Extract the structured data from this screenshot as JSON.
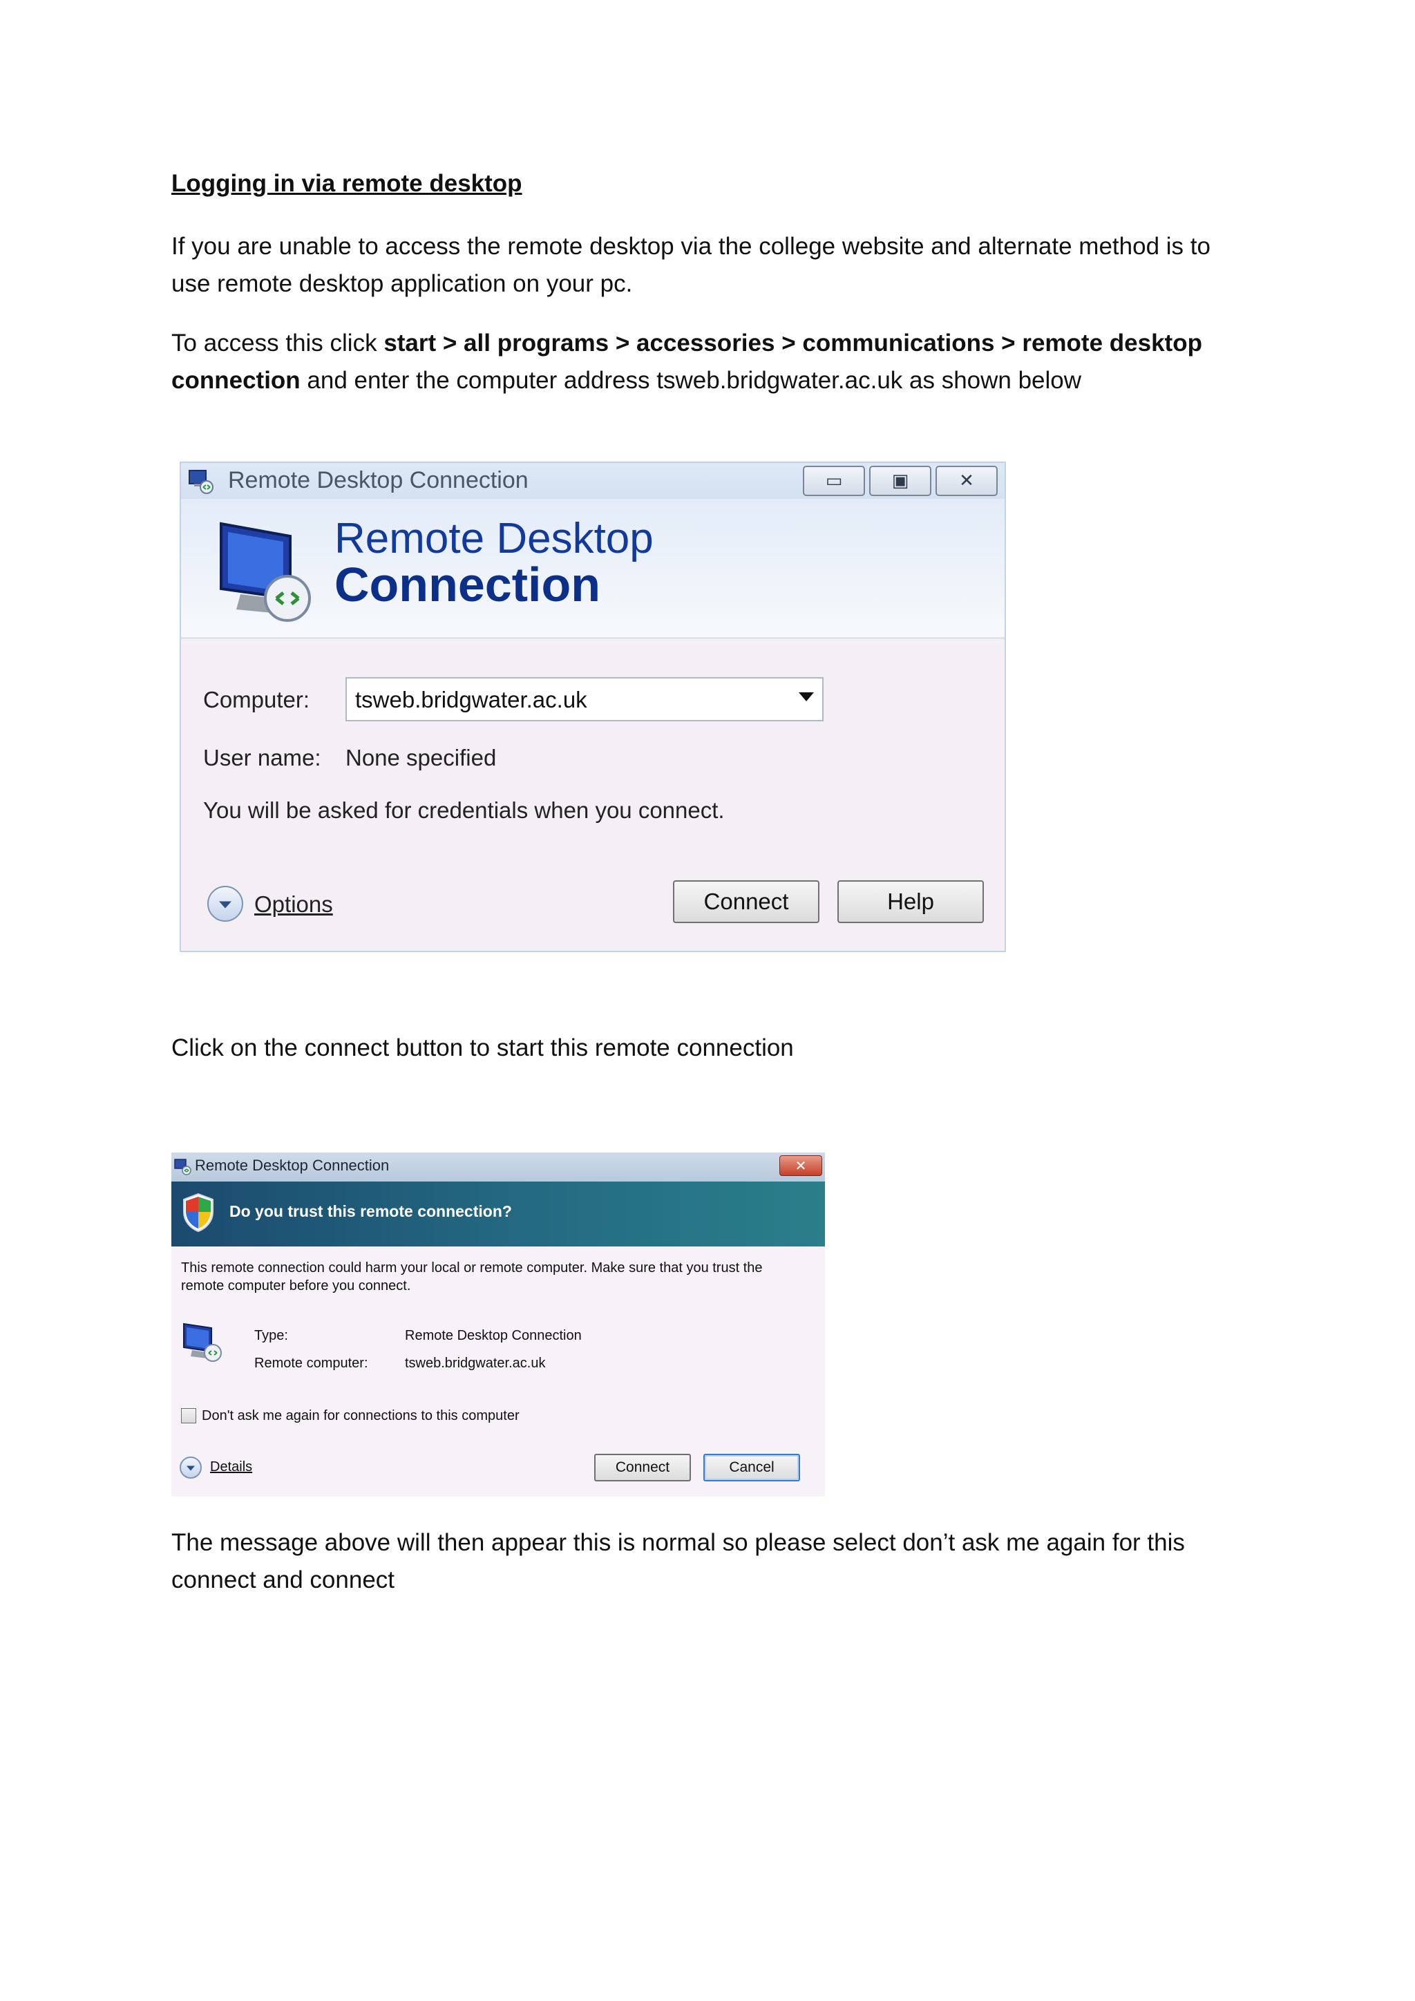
{
  "heading": "Logging in via remote desktop",
  "para1": "If you are unable to access the remote desktop via the college website and alternate method is to use remote desktop application on your pc.",
  "para2": {
    "lead": "To access this click ",
    "path_bold_1": "start > all programs > accessories > communications > remote desktop",
    "path_bold_2": "connection",
    "tail": " and enter the computer address tsweb.bridgwater.ac.uk as shown below"
  },
  "dialog1": {
    "window_title": "Remote Desktop Connection",
    "banner_line1": "Remote Desktop",
    "banner_line2": "Connection",
    "computer_label": "Computer:",
    "computer_value": "tsweb.bridgwater.ac.uk",
    "username_label": "User name:",
    "username_value": "None specified",
    "credentials_note": "You will be asked for credentials when you connect.",
    "options_label": "Options",
    "connect_label": "Connect",
    "help_label": "Help",
    "icons": [
      "remote-desktop-icon",
      "minimize-icon",
      "maximize-icon",
      "close-icon",
      "monitor-icon",
      "chevron-down-icon",
      "dropdown-arrow-icon"
    ]
  },
  "para3": "Click on the connect button to start this remote connection",
  "dialog2": {
    "window_title": "Remote Desktop Connection",
    "question": "Do you trust this remote connection?",
    "message": "This remote connection could harm your local or remote computer. Make sure that you trust the remote computer before you connect.",
    "type_label": "Type:",
    "type_value": "Remote Desktop Connection",
    "remote_label": "Remote computer:",
    "remote_value": "tsweb.bridgwater.ac.uk",
    "checkbox_label": "Don't ask me again for connections to this computer",
    "checkbox_checked": false,
    "details_label": "Details",
    "connect_label": "Connect",
    "cancel_label": "Cancel",
    "icons": [
      "remote-desktop-icon",
      "close-icon",
      "shield-icon",
      "monitor-icon",
      "chevron-down-icon"
    ]
  },
  "para4": "The message above will then appear this is normal so please select don’t ask me again for this connect and connect",
  "colors": {
    "banner_title": "#123a9c",
    "trust_header": "#1b4a6e",
    "close_button": "#c4402a"
  }
}
